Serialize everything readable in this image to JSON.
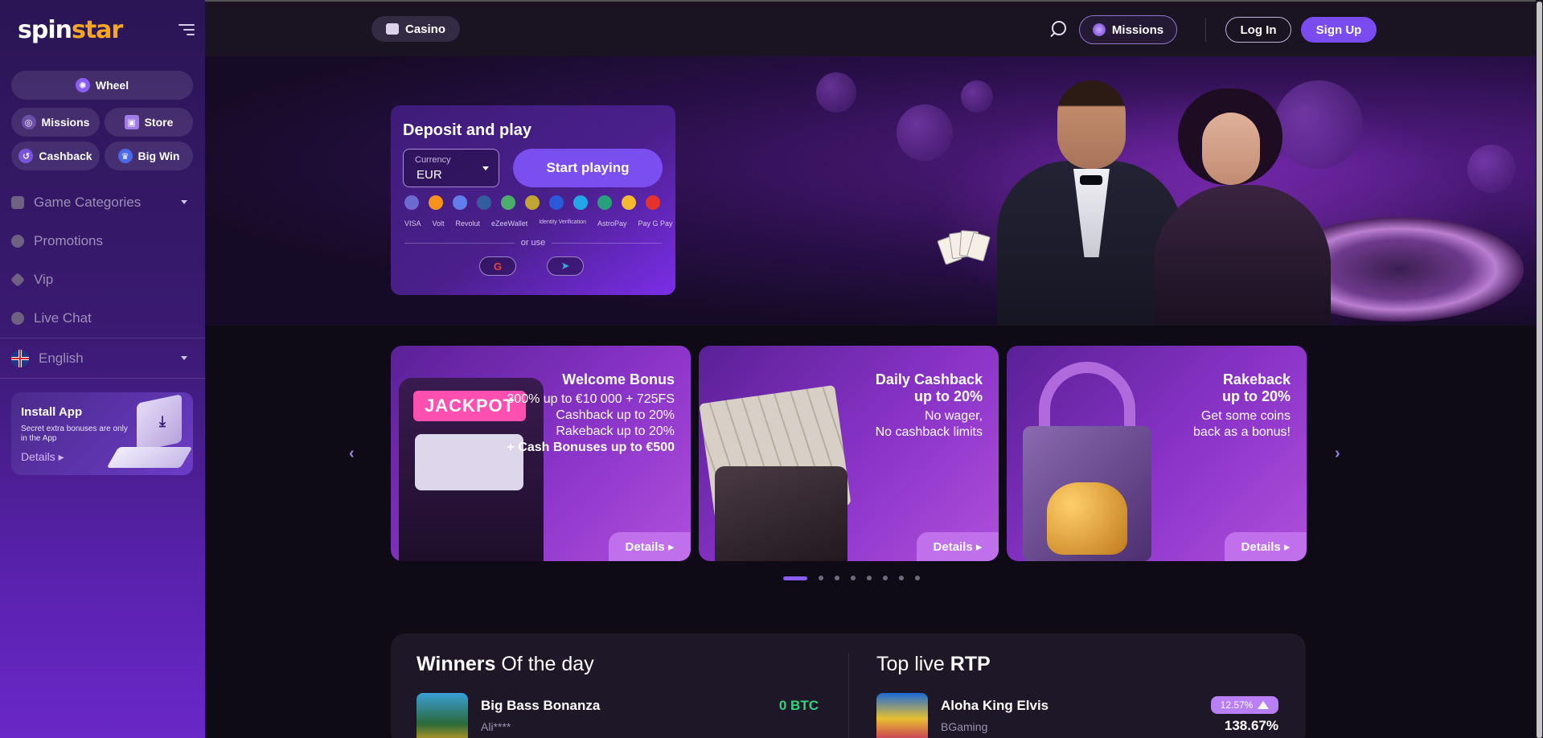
{
  "brand": {
    "logo_part1": "spin",
    "logo_part2": "star"
  },
  "sidebar": {
    "quick_links": {
      "wheel": "Wheel",
      "missions": "Missions",
      "store": "Store",
      "cashback": "Cashback",
      "big_win": "Big Win"
    },
    "nav": {
      "game_categories": "Game Categories",
      "promotions": "Promotions",
      "vip": "Vip",
      "live_chat": "Live Chat",
      "language": "English"
    },
    "install_app": {
      "title": "Install App",
      "text": "Secret extra bonuses are only in the App",
      "details": "Details ▸"
    }
  },
  "topbar": {
    "casino": "Casino",
    "missions": "Missions",
    "login": "Log In",
    "signup": "Sign Up"
  },
  "deposit": {
    "title": "Deposit and play",
    "currency_label": "Currency",
    "currency_value": "EUR",
    "start_button": "Start playing",
    "payment_methods": [
      "VISA",
      "Volt",
      "Revolut",
      "eZeeWallet",
      "Identity Verification",
      "AstroPay",
      "Pay G Pay"
    ],
    "or_use": "or use",
    "social_google": "G",
    "social_telegram": "➤"
  },
  "promos": [
    {
      "title": "Welcome Bonus",
      "lines": [
        "300% up to €10 000 + 725FS",
        "Cashback up to 20%",
        "Rakeback up to 20%",
        "+ Cash Bonuses up to €500"
      ],
      "details": "Details ▸"
    },
    {
      "title": "Daily Cashback",
      "title2": "up to 20%",
      "lines": [
        "No wager,",
        "No cashback limits"
      ],
      "details": "Details ▸"
    },
    {
      "title": "Rakeback",
      "title2": "up to 20%",
      "lines": [
        "Get some coins",
        "back as a bonus!"
      ],
      "details": "Details ▸"
    }
  ],
  "carousel": {
    "total_slides": 8,
    "active_slide": 1,
    "prev": "‹",
    "next": "›"
  },
  "winners": {
    "title_bold": "Winners",
    "title_rest": " Of the day",
    "game": "Big Bass Bonanza",
    "user": "Ali****",
    "amount": "0 BTC"
  },
  "top_rtp": {
    "title_light": "Top live ",
    "title_bold": "RTP",
    "game": "Aloha King Elvis",
    "provider": "BGaming",
    "badge": "12.57%",
    "value": "138.67%"
  },
  "colors": {
    "accent": "#7a4cf0",
    "promo_button": "#c170ec",
    "win_green": "#31d37b",
    "logo_orange": "#f5a623"
  }
}
